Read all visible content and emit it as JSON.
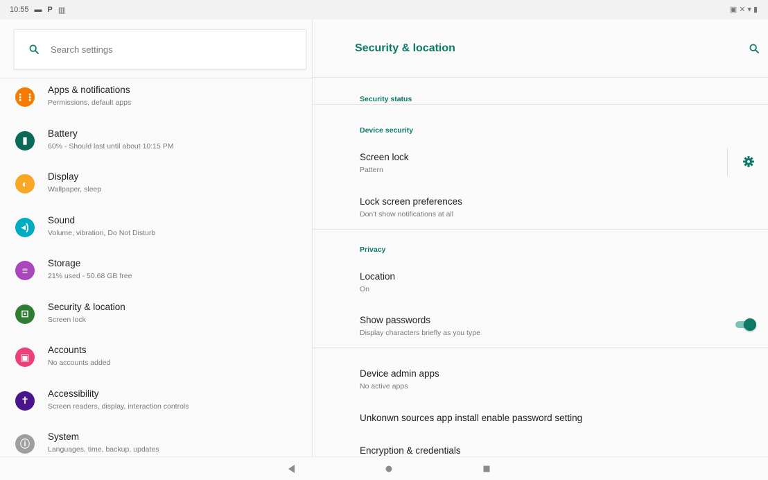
{
  "status_bar": {
    "time": "10:55",
    "icons_left": [
      "image-icon",
      "p-icon",
      "keyboard-icon"
    ],
    "icons_right": [
      "battery-saver-icon",
      "mute-icon",
      "wifi-icon",
      "battery-icon"
    ]
  },
  "search": {
    "placeholder": "Search settings"
  },
  "settings_list": [
    {
      "title": "Apps & notifications",
      "subtitle": "Permissions, default apps",
      "icon": "apps-icon",
      "color": "#f57c00"
    },
    {
      "title": "Battery",
      "subtitle": "60% - Should last until about 10:15 PM",
      "icon": "battery-icon",
      "color": "#0a6a58"
    },
    {
      "title": "Display",
      "subtitle": "Wallpaper, sleep",
      "icon": "brightness-icon",
      "color": "#f9a825"
    },
    {
      "title": "Sound",
      "subtitle": "Volume, vibration, Do Not Disturb",
      "icon": "volume-icon",
      "color": "#00acc1"
    },
    {
      "title": "Storage",
      "subtitle": "21% used - 50.68 GB free",
      "icon": "storage-icon",
      "color": "#ab47bc"
    },
    {
      "title": "Security & location",
      "subtitle": "Screen lock",
      "icon": "lock-icon",
      "color": "#2e7d32"
    },
    {
      "title": "Accounts",
      "subtitle": "No accounts added",
      "icon": "account-icon",
      "color": "#ec407a"
    },
    {
      "title": "Accessibility",
      "subtitle": "Screen readers, display, interaction controls",
      "icon": "accessibility-icon",
      "color": "#4a148c"
    },
    {
      "title": "System",
      "subtitle": "Languages, time, backup, updates",
      "icon": "info-icon",
      "color": "#9e9e9e"
    }
  ],
  "detail": {
    "title": "Security & location",
    "sections": {
      "security_status": "Security status",
      "device_security": "Device security",
      "privacy": "Privacy"
    },
    "items": {
      "screen_lock": {
        "title": "Screen lock",
        "subtitle": "Pattern"
      },
      "lock_screen_prefs": {
        "title": "Lock screen preferences",
        "subtitle": "Don't show notifications at all"
      },
      "location": {
        "title": "Location",
        "subtitle": "On"
      },
      "show_passwords": {
        "title": "Show passwords",
        "subtitle": "Display characters briefly as you type",
        "enabled": true
      },
      "device_admin": {
        "title": "Device admin apps",
        "subtitle": "No active apps"
      },
      "unknown_sources": {
        "title": "Unkonwn sources app install enable password setting"
      },
      "encryption": {
        "title": "Encryption & credentials"
      }
    }
  },
  "colors": {
    "accent": "#0c7a67"
  }
}
